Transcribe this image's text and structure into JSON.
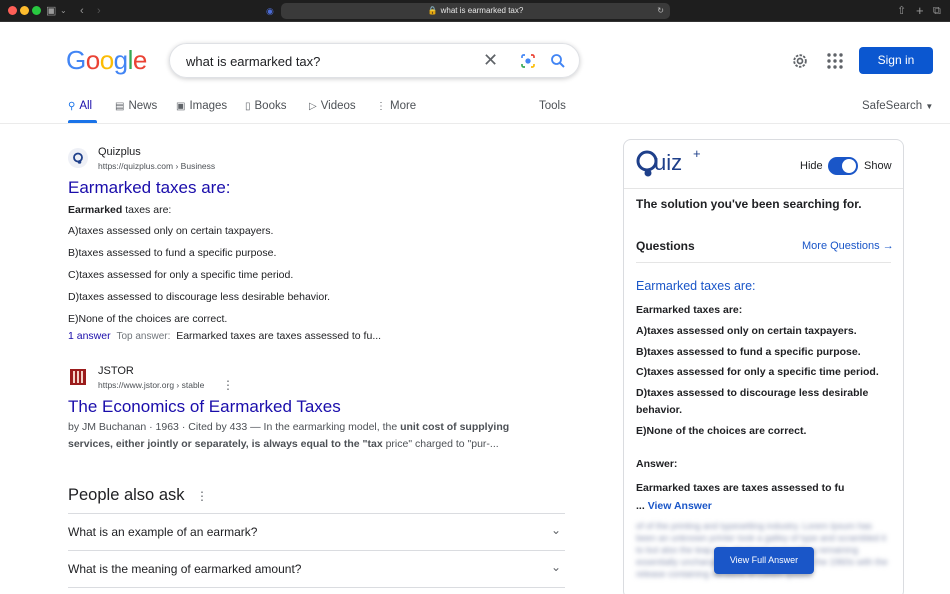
{
  "browser": {
    "address": "what is earmarked tax?"
  },
  "header": {
    "logo_letters": [
      "G",
      "o",
      "o",
      "g",
      "l",
      "e"
    ],
    "logo_colors": [
      "#4285f4",
      "#ea4335",
      "#fbbc05",
      "#4285f4",
      "#34a853",
      "#ea4335"
    ],
    "search_query": "what is earmarked tax?",
    "signin_label": "Sign in"
  },
  "tabs": {
    "all": "All",
    "news": "News",
    "images": "Images",
    "books": "Books",
    "videos": "Videos",
    "more": "More",
    "tools": "Tools",
    "safesearch": "SafeSearch"
  },
  "results": [
    {
      "site": "Quizplus",
      "url": "https://quizplus.com › Business",
      "title": "Earmarked taxes are:",
      "lead_bold": "Earmarked",
      "lead_rest": " taxes are:",
      "lines": [
        "A)taxes assessed only on certain taxpayers.",
        "B)taxes assessed to fund a specific purpose.",
        "C)taxes assessed for only a specific time period.",
        "D)taxes assessed to discourage less desirable behavior.",
        "E)None of the choices are correct."
      ],
      "answer_count": "1 answer",
      "top_answer_label": "Top answer:",
      "top_answer": "Earmarked taxes are taxes assessed to fu..."
    },
    {
      "site": "JSTOR",
      "url": "https://www.jstor.org › stable",
      "title": "The Economics of Earmarked Taxes",
      "meta": "by JM Buchanan · 1963 · Cited by 433 — In the earmarking model, the ",
      "bold1": "unit cost of supplying services, either jointly or separately, is always equal to the \"tax",
      "rest": " price\" charged to \"pur-..."
    }
  ],
  "paa": {
    "title": "People also ask",
    "questions": [
      "What is an example of an earmark?",
      "What is the meaning of earmarked amount?"
    ]
  },
  "quizplus_panel": {
    "logo_text": "uiz",
    "logo_sup": "+",
    "hide": "Hide",
    "show": "Show",
    "tagline": "The solution you've been searching for.",
    "questions_label": "Questions",
    "more_questions": "More Questions →",
    "question_title": "Earmarked taxes are:",
    "question_body": [
      "Earmarked taxes are:",
      "A)taxes assessed only on certain taxpayers.",
      "B)taxes assessed to fund a specific purpose.",
      "C)taxes assessed for only a specific time period.",
      "D)taxes assessed to discourage less desirable behavior.",
      "E)None of the choices are correct."
    ],
    "answer_label": "Answer:",
    "answer_text": "Earmarked taxes are taxes assessed to fu ...",
    "view_answer": "View Answer",
    "blur_text": "of of the printing and typesetting industry. Lorem Ipsum has been an unknown printer took a galley of type and scrambled it to but also the leap into electronic typesetting remaining essentially unchanged. It was popularised in the 1960s with the release containing versions of Lorem Ipsum.",
    "view_full_answer": "View Full Answer"
  }
}
